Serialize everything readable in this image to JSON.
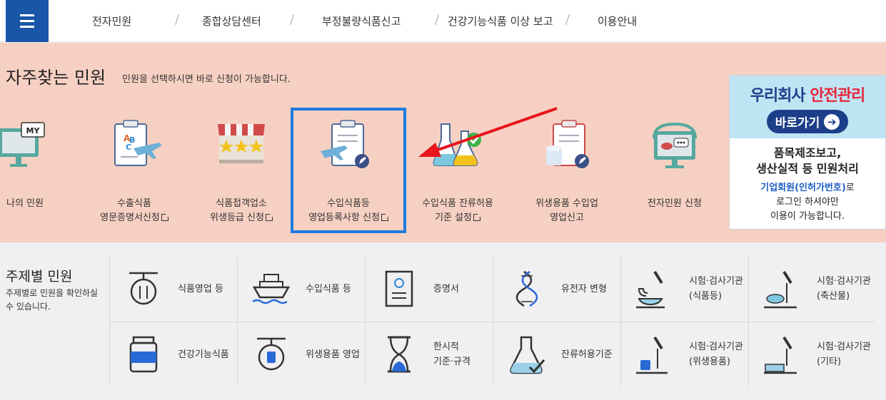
{
  "nav": {
    "items": [
      "전자민원",
      "종합상담센터",
      "부정불량식품신고",
      "건강기능식품 이상 보고",
      "이용안내"
    ],
    "separator": "/"
  },
  "favorites": {
    "title": "자주찾는 민원",
    "subtitle": "민원을 선택하시면 바로 신청이 가능합니다.",
    "items": [
      {
        "line1": "나의 민원",
        "line2": "",
        "icon": "my-monitor-icon"
      },
      {
        "line1": "수출식품",
        "line2": "영문증명서신청",
        "icon": "export-clipboard-plane-icon"
      },
      {
        "line1": "식품접객업소",
        "line2": "위생등급 신청",
        "icon": "store-stars-icon"
      },
      {
        "line1": "수입식품등",
        "line2": "영업등록사항 신청",
        "icon": "import-clipboard-plane-icon"
      },
      {
        "line1": "수입식품 잔류허용",
        "line2": "기준 설정",
        "icon": "flask-check-icon"
      },
      {
        "line1": "위생용품 수입업",
        "line2": "영업신고",
        "icon": "hygiene-clipboard-icon"
      },
      {
        "line1": "전자민원 신청",
        "line2": "",
        "icon": "monitor-chat-icon"
      }
    ]
  },
  "banner": {
    "title_a": "우리회사 ",
    "title_b": "안전관리",
    "go": "바로가기",
    "line1": "품목제조보고,",
    "line2": "생산실적 등 민원처리",
    "line3_blue": "기업회원(인허가번호)",
    "line3_rest": "로",
    "line4": "로그인 하셔야만",
    "line5": "이용이 가능합니다."
  },
  "topics": {
    "title": "주제별 민원",
    "desc": "주제별로 민원을 확인하실 수 있습니다.",
    "row1": [
      {
        "l1": "식품영업 등",
        "l2": "",
        "icon": "restaurant-sign-icon"
      },
      {
        "l1": "수입식품 등",
        "l2": "",
        "icon": "ship-icon"
      },
      {
        "l1": "증명서",
        "l2": "",
        "icon": "certificate-icon"
      },
      {
        "l1": "유전자 변형",
        "l2": "",
        "icon": "dna-icon"
      },
      {
        "l1": "시험·검사기관",
        "l2": "(식품등)",
        "icon": "microscope-bowl-icon"
      },
      {
        "l1": "시험·검사기관",
        "l2": "(축산물)",
        "icon": "microscope-fish-icon"
      }
    ],
    "row2": [
      {
        "l1": "건강기능식품",
        "l2": "",
        "icon": "supplement-jar-icon"
      },
      {
        "l1": "위생용품 영업",
        "l2": "",
        "icon": "hygiene-sign-icon"
      },
      {
        "l1": "한시적",
        "l2": "기준·규격",
        "icon": "hourglass-icon"
      },
      {
        "l1": "잔류허용기준",
        "l2": "",
        "icon": "flask-check-line-icon"
      },
      {
        "l1": "시험·검사기관",
        "l2": "(위생용품)",
        "icon": "microscope-cup-icon"
      },
      {
        "l1": "시험·검사기관",
        "l2": "(기타)",
        "icon": "microscope-box-icon"
      }
    ]
  }
}
